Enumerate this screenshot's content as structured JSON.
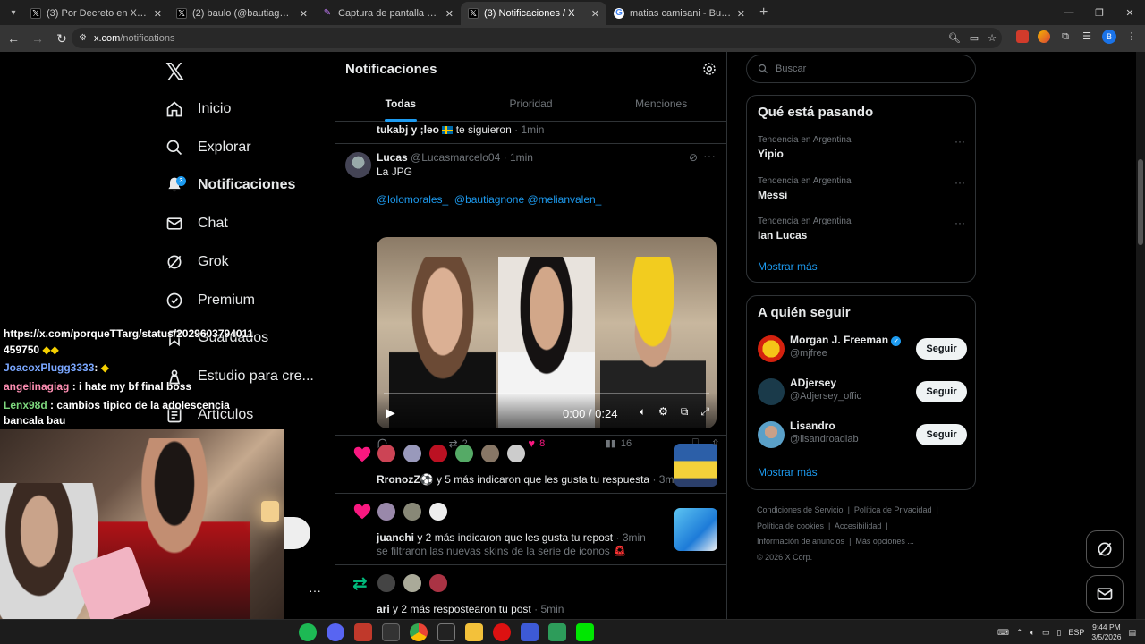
{
  "browser": {
    "tabs": [
      {
        "title": "(3) Por Decreto en X: \"\"A mi no",
        "fav_color": "#000"
      },
      {
        "title": "(2) baulo (@bautiagnone) / X",
        "fav_color": "#000"
      },
      {
        "title": "Captura de pantalla por Lightsh",
        "fav_color": "#7b2cbf"
      },
      {
        "title": "(3) Notificaciones / X",
        "fav_color": "#000"
      },
      {
        "title": "matias camisani - Buscar con G",
        "fav_color": "#fff"
      }
    ],
    "url_host": "x.com",
    "url_path": "/notifications",
    "profile_initial": "B"
  },
  "nav": {
    "items": [
      {
        "label": "Inicio"
      },
      {
        "label": "Explorar"
      },
      {
        "label": "Notificaciones",
        "badge": "3"
      },
      {
        "label": "Chat"
      },
      {
        "label": "Grok"
      },
      {
        "label": "Premium"
      },
      {
        "label": "Guardados"
      },
      {
        "label": "Estudio para cre..."
      },
      {
        "label": "Artículos"
      }
    ]
  },
  "stream_chat": {
    "link": "https://x.com/porqueTTarg/status/20296037940",
    "link_cont": "459750",
    "link_suffix": "11",
    "messages": [
      {
        "user": "JoacoxPlugg3333",
        "text": ":",
        "color": "#7aa7ff"
      },
      {
        "user": "angelinagiag",
        "text": ": i hate my bf final boss",
        "color": "#ff8fb3"
      },
      {
        "user": "Lenx98d",
        "text": ": cambios tipico de la adolescencia",
        "color": "#7cd67c"
      }
    ],
    "last_line": "bancala bau"
  },
  "main": {
    "title": "Notificaciones",
    "tabs": [
      {
        "label": "Todas"
      },
      {
        "label": "Prioridad"
      },
      {
        "label": "Menciones"
      }
    ],
    "followed_row": {
      "users": "tukabj y ;leo",
      "text": "te siguieron",
      "time": "1min"
    },
    "post": {
      "name": "Lucas",
      "handle": "@Lucasmarcelo04",
      "time": "1min",
      "text": "La JPG",
      "mentions": "@lolomorales_  @bautiagnone @melianvalen_",
      "video_time": "0:00 / 0:24",
      "video_progress": 0,
      "retweets": "2",
      "likes": "8",
      "views": "16"
    },
    "like_row": {
      "text_bold": "RronozZ",
      "text": " y 5 más indicaron que les gusta tu respuesta",
      "time": "3min"
    },
    "repost_like_row": {
      "text_bold": "juanchi",
      "text": " y 2 más indicaron que les gusta tu repost",
      "time": "3min",
      "subtext": "se filtraron las nuevas skins de la serie de iconos"
    },
    "retweet_row": {
      "text_bold": "ari",
      "text": " y 2 más respostearon tu post",
      "time": "5min"
    }
  },
  "right": {
    "search_placeholder": "Buscar",
    "trends_title": "Qué está pasando",
    "trends": [
      {
        "context": "Tendencia en Argentina",
        "name": "Yipio"
      },
      {
        "context": "Tendencia en Argentina",
        "name": "Messi"
      },
      {
        "context": "Tendencia en Argentina",
        "name": "Ian Lucas"
      }
    ],
    "show_more": "Mostrar más",
    "follow_title": "A quién seguir",
    "follow": [
      {
        "name": "Morgan J. Freeman",
        "handle": "@mjfree",
        "button": "Seguir",
        "verified": true
      },
      {
        "name": "ADjersey",
        "handle": "@Adjersey_offic",
        "button": "Seguir"
      },
      {
        "name": "Lisandro",
        "handle": "@lisandroadiab",
        "button": "Seguir"
      }
    ],
    "follow_show_more": "Mostrar más",
    "footer": {
      "links1": [
        "Condiciones de Servicio",
        "Política de Privacidad"
      ],
      "links2": [
        "Política de cookies",
        "Accesibilidad"
      ],
      "links3": [
        "Información de anuncios",
        "Más opciones ..."
      ],
      "copyright": "© 2026 X Corp."
    }
  },
  "taskbar": {
    "lang": "ESP",
    "time": "9:44 PM",
    "date": "3/5/2026"
  },
  "colors": {
    "accent": "#1d9bf0",
    "like": "#f91880",
    "retweet": "#00ba7c"
  }
}
